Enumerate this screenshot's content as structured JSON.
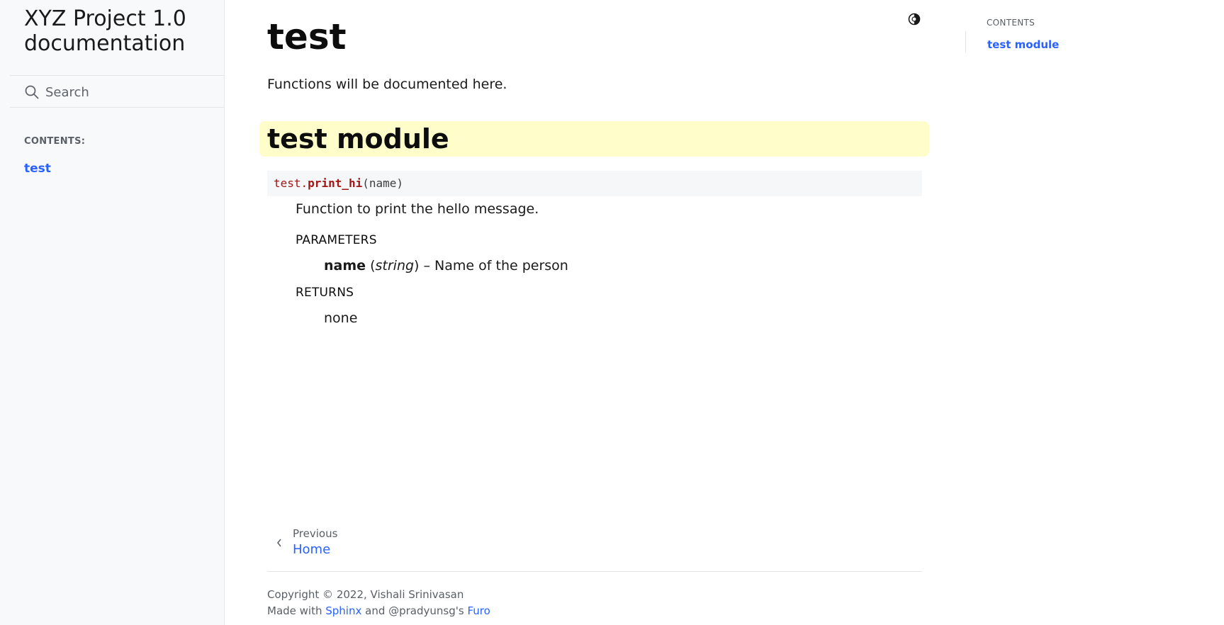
{
  "sidebar": {
    "brand": "XYZ Project 1.0 documentation",
    "search_placeholder": "Search",
    "caption": "CONTENTS:",
    "items": [
      {
        "label": "test"
      }
    ]
  },
  "header": {
    "theme_toggle_icon": "contrast-toggle-icon"
  },
  "main": {
    "title": "test",
    "intro": "Functions will be documented here.",
    "section_heading": "test module",
    "signature": {
      "module": "test.",
      "name": "print_hi",
      "open_paren": "(",
      "arg": "name",
      "close_paren": ")"
    },
    "description": "Function to print the hello message.",
    "parameters_label": "PARAMETERS",
    "param": {
      "name": "name",
      "type_open": " (",
      "type": "string",
      "type_close": ")",
      "desc": " – Name of the person"
    },
    "returns_label": "RETURNS",
    "returns_value": "none"
  },
  "prev_nav": {
    "caption": "Previous",
    "title": "Home"
  },
  "footer": {
    "copyright": "Copyright © 2022, Vishali Srinivasan",
    "made_with": "Made with ",
    "sphinx": "Sphinx",
    "and_text": " and @pradyunsg's ",
    "furo": "Furo"
  },
  "toc": {
    "caption": "CONTENTS",
    "items": [
      {
        "label": "test module"
      }
    ]
  },
  "colors": {
    "link": "#2962ff",
    "highlight": "#fffdc9",
    "sig_name": "#a31515",
    "sidebar_bg": "#f8f9fb"
  }
}
